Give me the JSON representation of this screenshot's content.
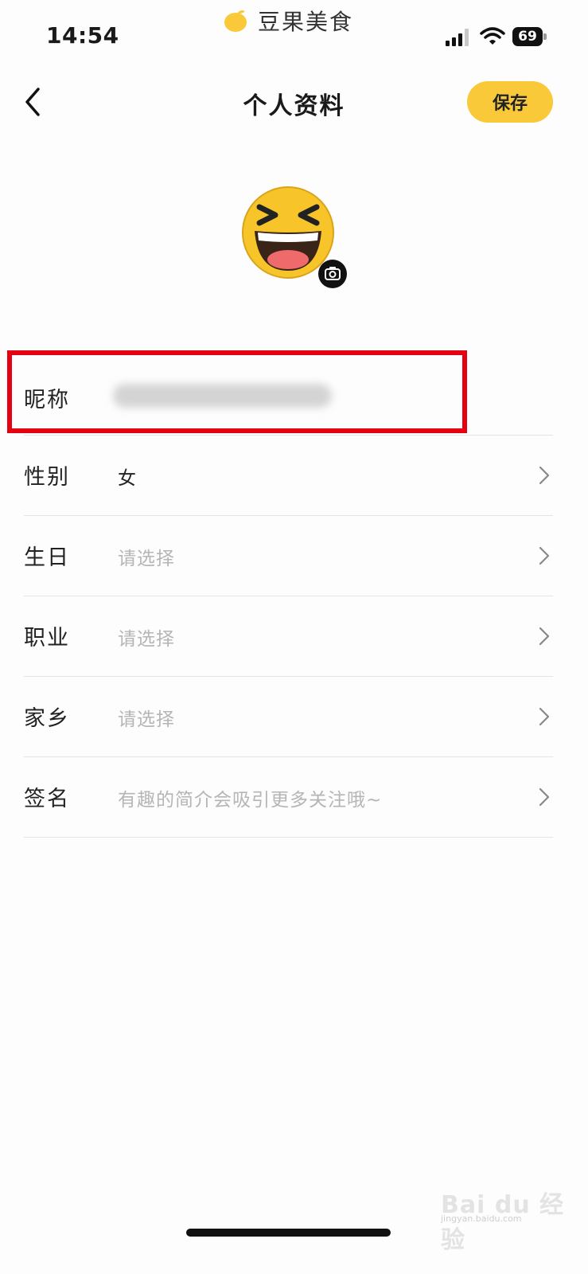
{
  "status_bar": {
    "time": "14:54",
    "app_name": "豆果美食",
    "battery": "69"
  },
  "header": {
    "title": "个人资料",
    "save_label": "保存"
  },
  "profile": {
    "avatar": "laughing-emoji-avatar"
  },
  "form": {
    "nickname_label": "昵称",
    "rows": [
      {
        "label": "性别",
        "value": "女",
        "filled": true
      },
      {
        "label": "生日",
        "value": "请选择",
        "filled": false
      },
      {
        "label": "职业",
        "value": "请选择",
        "filled": false
      },
      {
        "label": "家乡",
        "value": "请选择",
        "filled": false
      },
      {
        "label": "签名",
        "value": "有趣的简介会吸引更多关注哦~",
        "filled": false
      }
    ]
  },
  "watermark": {
    "main": "Bai du 经验",
    "sub": "jingyan.baidu.com"
  },
  "colors": {
    "accent": "#f9c93a",
    "highlight": "#e50012",
    "placeholder": "#b5b5b5"
  }
}
